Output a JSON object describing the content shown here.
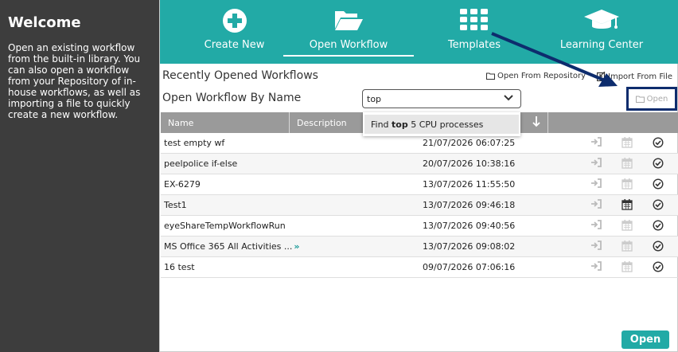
{
  "sidebar": {
    "title": "Welcome",
    "description": "Open an existing workflow from the built-in library. You can also open a workflow from your Repository of in-house workflows, as well as importing a file to quickly create a new workflow."
  },
  "nav": {
    "items": [
      {
        "label": "Create New",
        "icon": "plus-circle-icon"
      },
      {
        "label": "Open Workflow",
        "icon": "folder-open-icon",
        "active": true
      },
      {
        "label": "Templates",
        "icon": "grid-icon"
      },
      {
        "label": "Learning Center",
        "icon": "graduation-cap-icon"
      }
    ]
  },
  "main": {
    "recent_title": "Recently Opened Workflows",
    "open_by_name_label": "Open Workflow By Name",
    "open_from_repository": "Open From Repository",
    "import_from_file": "Import From File",
    "open_small_label": "Open",
    "name_input_value": "top",
    "dropdown_option": {
      "prefix": "Find ",
      "match": "top",
      "suffix": " 5 CPU processes"
    },
    "columns": {
      "name": "Name",
      "description": "Description"
    },
    "rows": [
      {
        "name": "test empty wf",
        "date": "21/07/2026 06:07:25",
        "calendar_active": false
      },
      {
        "name": "peelpolice if-else",
        "date": "20/07/2026 10:38:16",
        "calendar_active": false
      },
      {
        "name": "EX-6279",
        "date": "13/07/2026 11:55:50",
        "calendar_active": false
      },
      {
        "name": "Test1",
        "date": "13/07/2026 09:46:18",
        "calendar_active": true
      },
      {
        "name": "eyeShareTempWorkflowRun",
        "date": "13/07/2026 09:40:56",
        "calendar_active": false
      },
      {
        "name": "MS Office 365 All Activities ...",
        "more": "»",
        "date": "13/07/2026 09:08:02",
        "calendar_active": false
      },
      {
        "name": "16 test",
        "date": "09/07/2026 07:06:16",
        "calendar_active": false
      }
    ],
    "open_button": "Open"
  },
  "colors": {
    "accent": "#22aaa6",
    "sidebar_bg": "#3d3d3d",
    "header_bg": "#9a9a9a",
    "highlight_border": "#0d2c6d"
  }
}
